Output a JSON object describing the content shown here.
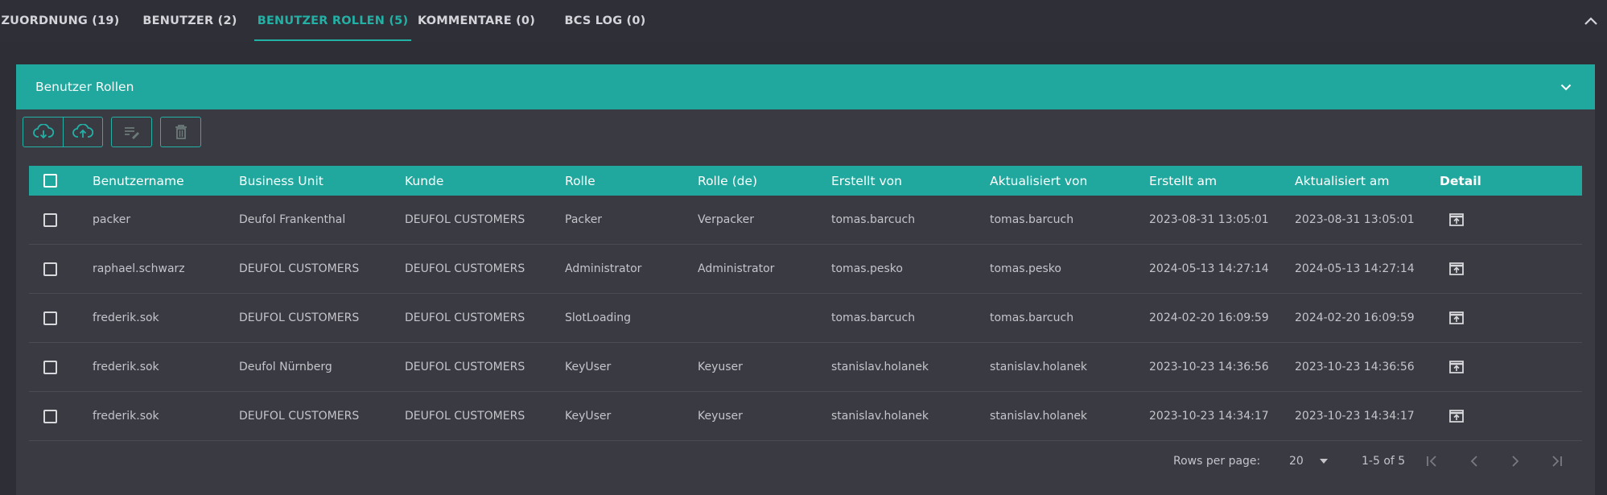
{
  "tabs": [
    {
      "label": "ZUORDNUNG (19)"
    },
    {
      "label": "BENUTZER (2)"
    },
    {
      "label": "BENUTZER ROLLEN (5)",
      "active": true
    },
    {
      "label": "KOMMENTARE (0)"
    },
    {
      "label": "BCS LOG (0)"
    }
  ],
  "panel": {
    "title": "Benutzer Rollen",
    "toolbar": [
      "cloud-download-icon",
      "cloud-upload-icon",
      "edit-list-icon",
      "trash-icon"
    ]
  },
  "table": {
    "columns": [
      "Benutzername",
      "Business Unit",
      "Kunde",
      "Rolle",
      "Rolle (de)",
      "Erstellt von",
      "Aktualisiert von",
      "Erstellt am",
      "Aktualisiert am",
      "Detail"
    ],
    "rows": [
      [
        "packer",
        "Deufol Frankenthal",
        "DEUFOL CUSTOMERS",
        "Packer",
        "Verpacker",
        "tomas.barcuch",
        "tomas.barcuch",
        "2023-08-31 13:05:01",
        "2023-08-31 13:05:01"
      ],
      [
        "raphael.schwarz",
        "DEUFOL CUSTOMERS",
        "DEUFOL CUSTOMERS",
        "Administrator",
        "Administrator",
        "tomas.pesko",
        "tomas.pesko",
        "2024-05-13 14:27:14",
        "2024-05-13 14:27:14"
      ],
      [
        "frederik.sok",
        "DEUFOL CUSTOMERS",
        "DEUFOL CUSTOMERS",
        "SlotLoading",
        "",
        "tomas.barcuch",
        "tomas.barcuch",
        "2024-02-20 16:09:59",
        "2024-02-20 16:09:59"
      ],
      [
        "frederik.sok",
        "Deufol Nürnberg",
        "DEUFOL CUSTOMERS",
        "KeyUser",
        "Keyuser",
        "stanislav.holanek",
        "stanislav.holanek",
        "2023-10-23 14:36:56",
        "2023-10-23 14:36:56"
      ],
      [
        "frederik.sok",
        "DEUFOL CUSTOMERS",
        "DEUFOL CUSTOMERS",
        "KeyUser",
        "Keyuser",
        "stanislav.holanek",
        "stanislav.holanek",
        "2023-10-23 14:34:17",
        "2023-10-23 14:34:17"
      ]
    ]
  },
  "pagination": {
    "rows_per_page_label": "Rows per page:",
    "rows_per_page_value": "20",
    "range": "1-5 of 5"
  },
  "colors": {
    "accent": "#21a89e",
    "background": "#2e2f36",
    "panel": "#393a42"
  }
}
